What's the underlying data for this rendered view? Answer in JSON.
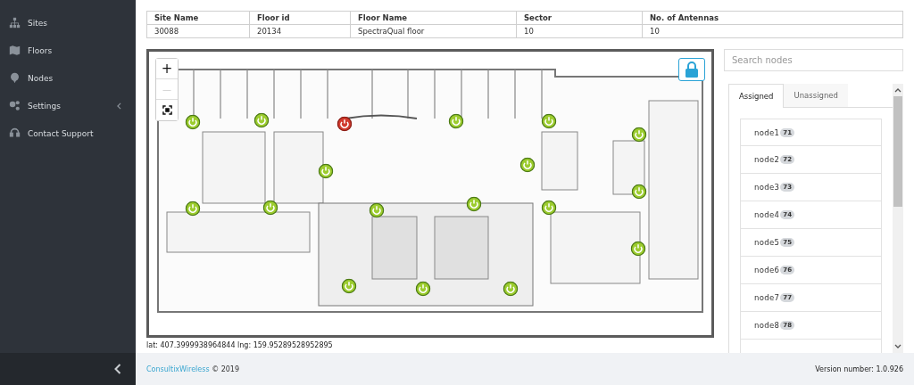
{
  "sidebar": {
    "items": [
      {
        "label": "Sites",
        "expandable": false
      },
      {
        "label": "Floors",
        "expandable": false
      },
      {
        "label": "Nodes",
        "expandable": false
      },
      {
        "label": "Settings",
        "expandable": true
      },
      {
        "label": "Contact Support",
        "expandable": false
      }
    ]
  },
  "table": {
    "columns": [
      "Site Name",
      "Floor id",
      "Floor Name",
      "Sector",
      "No. of Antennas"
    ],
    "rows": [
      [
        "30088",
        "20134",
        "SpectraQual floor",
        "10",
        "10"
      ]
    ]
  },
  "map": {
    "zoom_in": "+",
    "zoom_out": "—",
    "locked": true,
    "markers": [
      {
        "on": true
      },
      {
        "on": true
      },
      {
        "on": false
      },
      {
        "on": true
      },
      {
        "on": true
      },
      {
        "on": true
      },
      {
        "on": true
      },
      {
        "on": true
      },
      {
        "on": true
      },
      {
        "on": true
      },
      {
        "on": true
      },
      {
        "on": true
      },
      {
        "on": true
      },
      {
        "on": true
      },
      {
        "on": true
      },
      {
        "on": true
      },
      {
        "on": true
      },
      {
        "on": true
      }
    ],
    "coordinates": "lat: 407.3999938964844 lng: 159.95289528952895"
  },
  "search": {
    "placeholder": "Search nodes"
  },
  "tabs": [
    {
      "label": "Assigned",
      "selected": true
    },
    {
      "label": "Unassigned",
      "selected": false
    }
  ],
  "nodes": [
    {
      "name": "node1",
      "badge": "71"
    },
    {
      "name": "node2",
      "badge": "72"
    },
    {
      "name": "node3",
      "badge": "73"
    },
    {
      "name": "node4",
      "badge": "74"
    },
    {
      "name": "node5",
      "badge": "75"
    },
    {
      "name": "node6",
      "badge": "76"
    },
    {
      "name": "node7",
      "badge": "77"
    },
    {
      "name": "node8",
      "badge": "78"
    }
  ],
  "footer": {
    "brand": "ConsultixWireless",
    "copyright": "© 2019",
    "version": "Version number: 1.0.926"
  }
}
